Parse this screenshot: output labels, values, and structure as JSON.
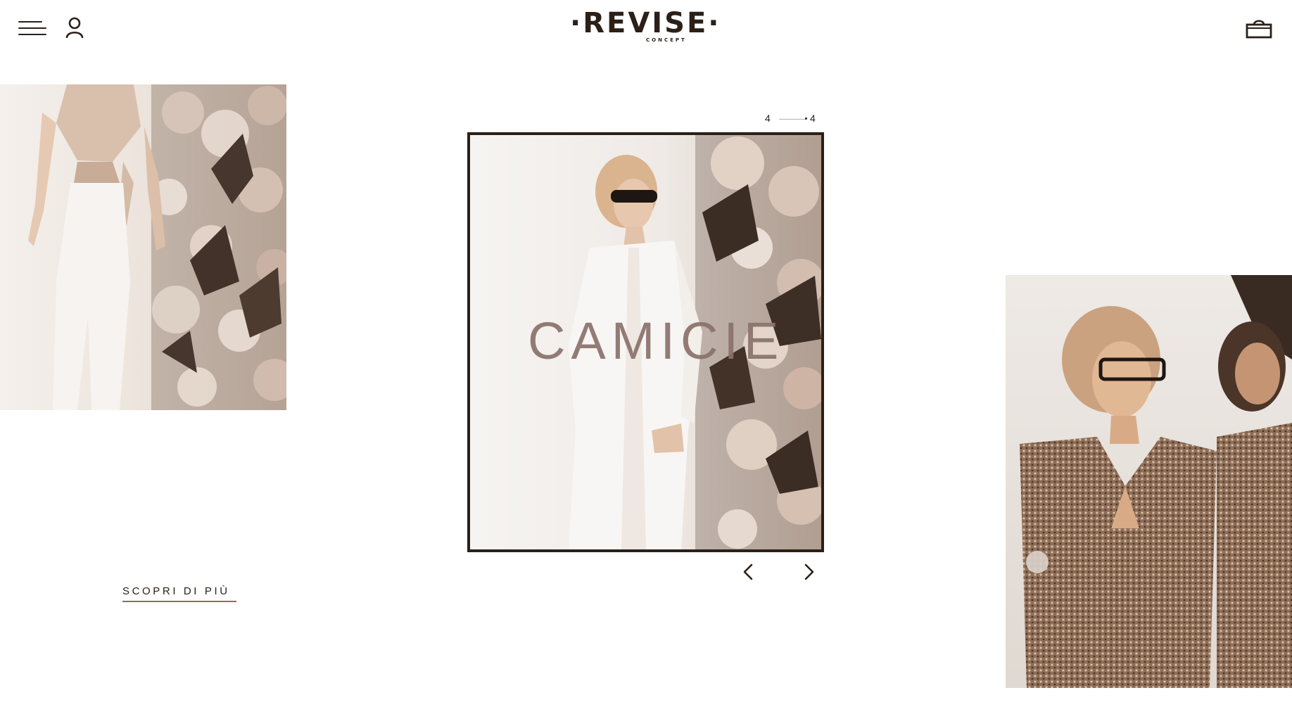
{
  "header": {
    "logo_text": "·REVISE·",
    "logo_subtext": "CONCEPT",
    "menu_icon": "hamburger-icon",
    "account_icon": "user-icon",
    "cart_icon": "shopping-bag-icon"
  },
  "left_panel": {
    "discover_label": "SCOPRI DI PIÙ"
  },
  "slider": {
    "current": "4",
    "total": "4",
    "slide_title": "CAMICIE",
    "prev_icon": "chevron-left-icon",
    "next_icon": "chevron-right-icon"
  },
  "colors": {
    "ink": "#2b2018",
    "title_mauve": "#8a726b",
    "underline": "#8a6d5f"
  }
}
